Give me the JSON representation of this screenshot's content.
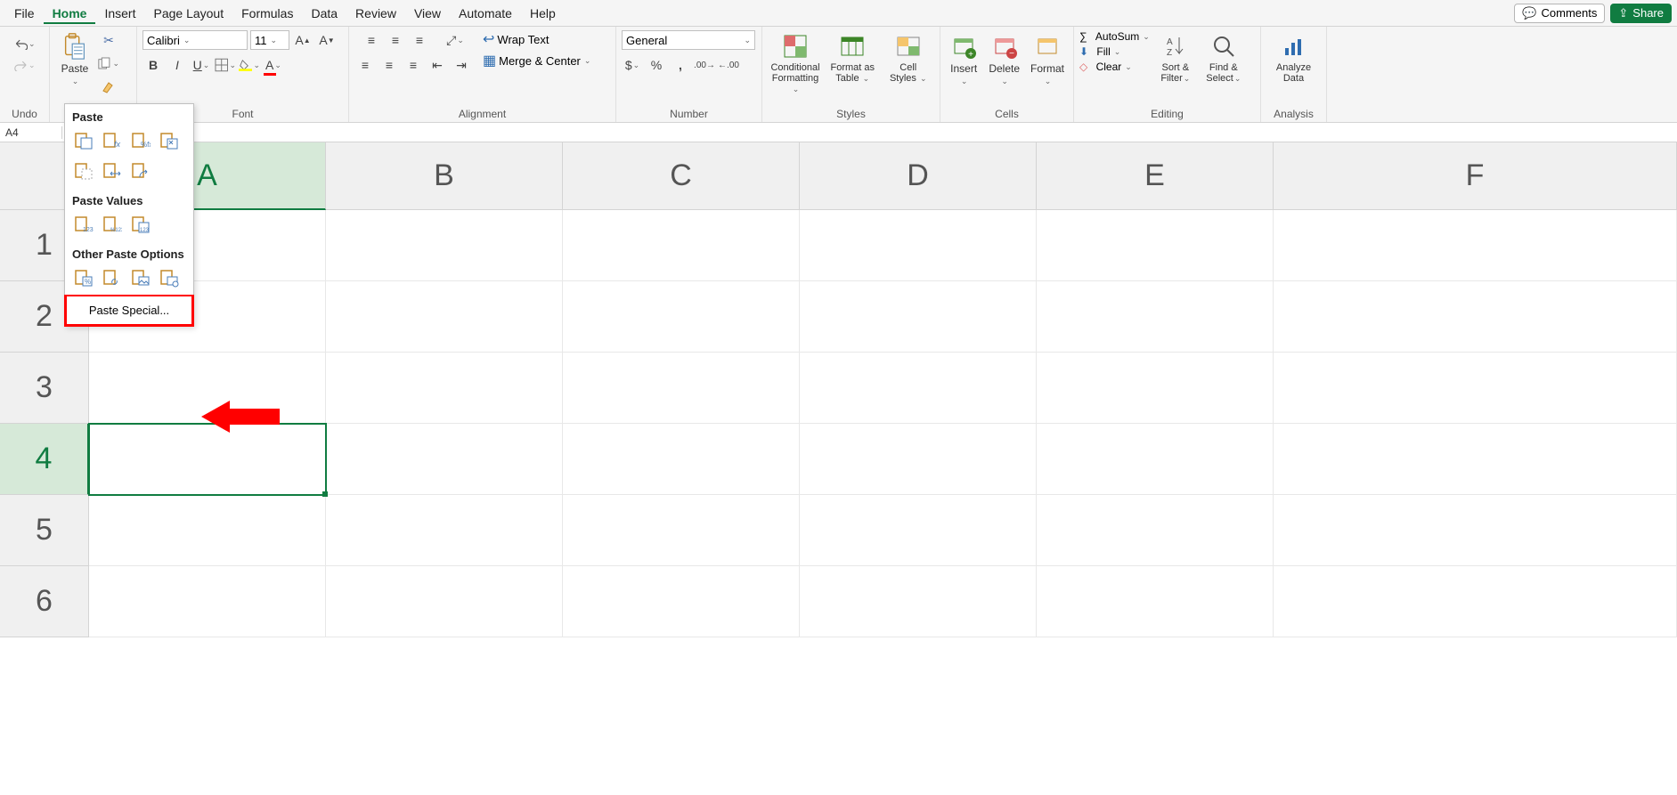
{
  "menu": {
    "file": "File",
    "home": "Home",
    "insert": "Insert",
    "pageLayout": "Page Layout",
    "formulas": "Formulas",
    "data": "Data",
    "review": "Review",
    "view": "View",
    "automate": "Automate",
    "help": "Help",
    "comments": "Comments",
    "share": "Share"
  },
  "ribbon": {
    "undo": {
      "label": "Undo"
    },
    "clipboard": {
      "paste": "Paste",
      "label": ""
    },
    "font": {
      "name": "Calibri",
      "size": "11",
      "label": "Font"
    },
    "alignment": {
      "wrap": "Wrap Text",
      "merge": "Merge & Center",
      "label": "Alignment"
    },
    "number": {
      "format": "General",
      "label": "Number"
    },
    "styles": {
      "cond": "Conditional Formatting",
      "table": "Format as Table",
      "cell": "Cell Styles",
      "label": "Styles"
    },
    "cells": {
      "insert": "Insert",
      "delete": "Delete",
      "format": "Format",
      "label": "Cells"
    },
    "editing": {
      "autosum": "AutoSum",
      "fill": "Fill",
      "clear": "Clear",
      "sort": "Sort & Filter",
      "find": "Find & Select",
      "label": "Editing"
    },
    "analysis": {
      "analyze": "Analyze Data",
      "label": "Analysis"
    }
  },
  "namebox": "A4",
  "columns": [
    "A",
    "B",
    "C",
    "D",
    "E",
    "F"
  ],
  "rows": [
    "1",
    "2",
    "3",
    "4",
    "5",
    "6"
  ],
  "selectedCell": {
    "col": "A",
    "row": "4"
  },
  "pastePopup": {
    "section1": "Paste",
    "section2": "Paste Values",
    "section3": "Other Paste Options",
    "special": "Paste Special..."
  }
}
